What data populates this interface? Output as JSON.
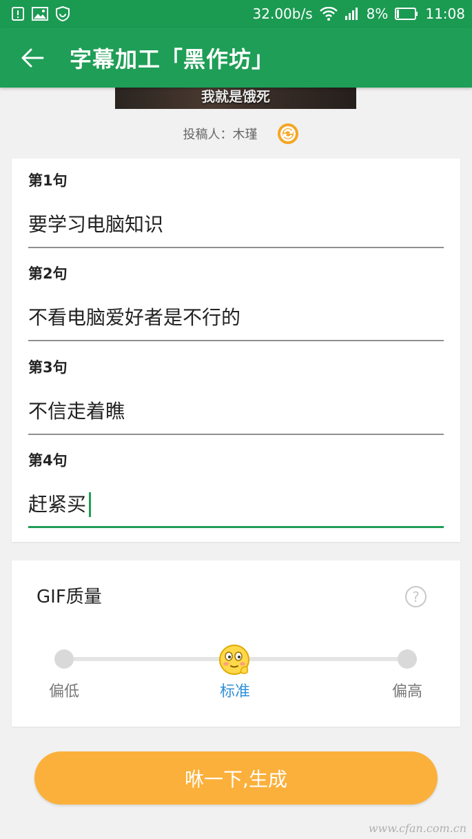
{
  "status_bar": {
    "speed": "32.00b/s",
    "battery": "8%",
    "time": "11:08",
    "icons": [
      "alert-icon",
      "image-icon",
      "shield-icon",
      "wifi-icon",
      "signal-icon",
      "battery-icon"
    ]
  },
  "app_bar": {
    "title": "字幕加工「黑作坊」",
    "back_icon": "back-arrow-icon"
  },
  "preview": {
    "subtitle": "我就是饿死"
  },
  "uploader": {
    "text": "投稿人：木瑾",
    "refresh_icon": "refresh-icon"
  },
  "lines": [
    {
      "label": "第1句",
      "value": "要学习电脑知识"
    },
    {
      "label": "第2句",
      "value": "不看电脑爱好者是不行的"
    },
    {
      "label": "第3句",
      "value": "不信走着瞧"
    },
    {
      "label": "第4句",
      "value": "赶紧买"
    }
  ],
  "quality": {
    "title": "GIF质量",
    "help": "?",
    "options": [
      "偏低",
      "标准",
      "偏高"
    ],
    "selected": "标准"
  },
  "generate_button": "咻一下,生成",
  "watermark": "www.cfan.com.cn",
  "colors": {
    "primary_green": "#1e9e56",
    "accent_orange": "#fbb03b",
    "selected_blue": "#2f8fd8"
  }
}
